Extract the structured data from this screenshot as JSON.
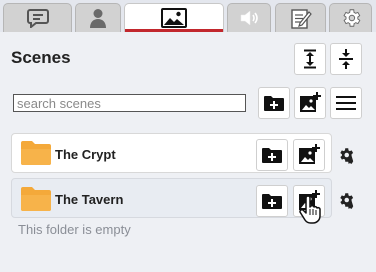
{
  "tabs": [
    {
      "name": "chat",
      "icon": "chat-icon",
      "active": false
    },
    {
      "name": "characters",
      "icon": "person-icon",
      "active": false
    },
    {
      "name": "scenes",
      "icon": "image-icon",
      "active": true
    },
    {
      "name": "audio",
      "icon": "speaker-icon",
      "active": false
    },
    {
      "name": "notes",
      "icon": "notepad-icon",
      "active": false
    },
    {
      "name": "settings",
      "icon": "gear-icon",
      "active": false
    }
  ],
  "panel": {
    "title": "Scenes"
  },
  "search": {
    "placeholder": "search scenes",
    "value": ""
  },
  "folders": [
    {
      "name": "The Crypt",
      "expanded": false
    },
    {
      "name": "The Tavern",
      "expanded": true,
      "empty_text": "This folder is empty"
    }
  ],
  "colors": {
    "active_tab_accent": "#c2272d",
    "folder": "#f4a93a",
    "panel_bg": "#eef0f4"
  }
}
